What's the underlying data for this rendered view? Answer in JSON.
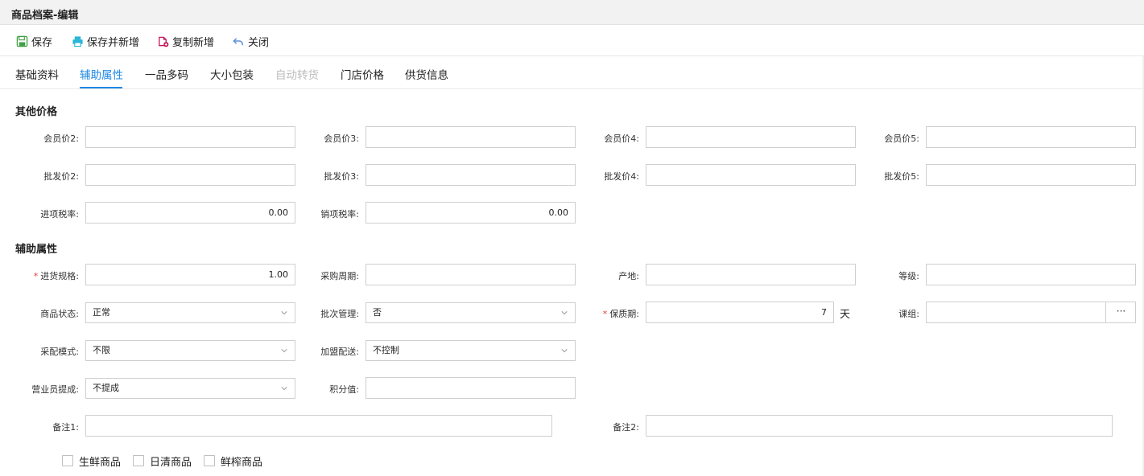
{
  "window": {
    "title": "商品档案-编辑"
  },
  "toolbar": {
    "save": "保存",
    "save_new": "保存并新增",
    "copy_new": "复制新增",
    "close": "关闭"
  },
  "tabs": [
    "基础资料",
    "辅助属性",
    "一品多码",
    "大小包装",
    "自动转货",
    "门店价格",
    "供货信息"
  ],
  "other_prices": {
    "heading": "其他价格",
    "member2": {
      "label": "会员价2:",
      "value": ""
    },
    "member3": {
      "label": "会员价3:",
      "value": ""
    },
    "member4": {
      "label": "会员价4:",
      "value": ""
    },
    "member5": {
      "label": "会员价5:",
      "value": ""
    },
    "wholesale2": {
      "label": "批发价2:",
      "value": ""
    },
    "wholesale3": {
      "label": "批发价3:",
      "value": ""
    },
    "wholesale4": {
      "label": "批发价4:",
      "value": ""
    },
    "wholesale5": {
      "label": "批发价5:",
      "value": ""
    },
    "input_tax": {
      "label": "进项税率:",
      "value": "0.00"
    },
    "output_tax": {
      "label": "销项税率:",
      "value": "0.00"
    }
  },
  "aux": {
    "heading": "辅助属性",
    "purchase_spec": {
      "label": "进货规格:",
      "value": "1.00",
      "required": "*"
    },
    "purchase_cycle": {
      "label": "采购周期:",
      "value": ""
    },
    "origin": {
      "label": "产地:",
      "value": ""
    },
    "grade": {
      "label": "等级:",
      "value": ""
    },
    "status": {
      "label": "商品状态:",
      "value": "正常"
    },
    "batch": {
      "label": "批次管理:",
      "value": "否"
    },
    "shelf_life": {
      "label": "保质期:",
      "value": "7",
      "unit": "天",
      "required": "*"
    },
    "group": {
      "label": "课组:",
      "value": "",
      "button": "···"
    },
    "dist_mode": {
      "label": "采配模式:",
      "value": "不限"
    },
    "franchise": {
      "label": "加盟配送:",
      "value": "不控制"
    },
    "commission": {
      "label": "营业员提成:",
      "value": "不提成"
    },
    "points": {
      "label": "积分值:",
      "value": ""
    },
    "note1": {
      "label": "备注1:",
      "value": ""
    },
    "note2": {
      "label": "备注2:",
      "value": ""
    }
  },
  "checkboxes": [
    "生鲜商品",
    "日清商品",
    "鲜榨商品"
  ]
}
